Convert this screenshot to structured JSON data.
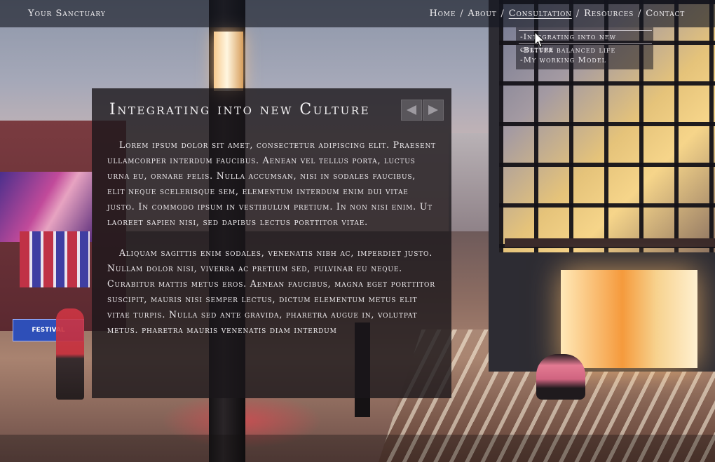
{
  "site": {
    "brand": "Your Sanctuary"
  },
  "nav": {
    "items": [
      {
        "label": "Home",
        "active": false
      },
      {
        "label": "About",
        "active": false
      },
      {
        "label": "Consultation",
        "active": true
      },
      {
        "label": "Resources",
        "active": false
      },
      {
        "label": "Contact",
        "active": false
      }
    ],
    "separator": "/"
  },
  "dropdown": {
    "items": [
      "-Integrating into new culture",
      "-Better balanced life",
      "-My working Model"
    ]
  },
  "article": {
    "title": "Integrating into new Culture",
    "paragraphs": [
      "Lorem ipsum dolor sit amet, consectetur adipiscing elit. Praesent ullamcorper interdum faucibus. Aenean vel tellus porta, luctus urna eu, ornare felis. Nulla accumsan, nisi in sodales faucibus, elit neque scelerisque sem, elementum interdum enim dui vitae justo. In commodo ipsum in vestibulum pretium. In non nisi enim. Ut laoreet sapien nisi, sed dapibus lectus porttitor vitae.",
      "Aliquam sagittis enim sodales, venenatis nibh ac, imperdiet justo. Nullam dolor nisi, viverra ac pretium sed, pulvinar eu neque. Curabitur mattis metus eros. Aenean faucibus, magna eget porttitor suscipit, mauris nisi semper lectus, dictum elementum metus elit vitae turpis. Nulla sed ante gravida, pharetra augue in, volutpat metus. pharetra mauris venenatis diam interdum"
    ]
  },
  "controls": {
    "prev_icon": "arrow-left-icon",
    "next_icon": "arrow-right-icon"
  },
  "scene": {
    "festival_sign": "FESTIVAL"
  }
}
